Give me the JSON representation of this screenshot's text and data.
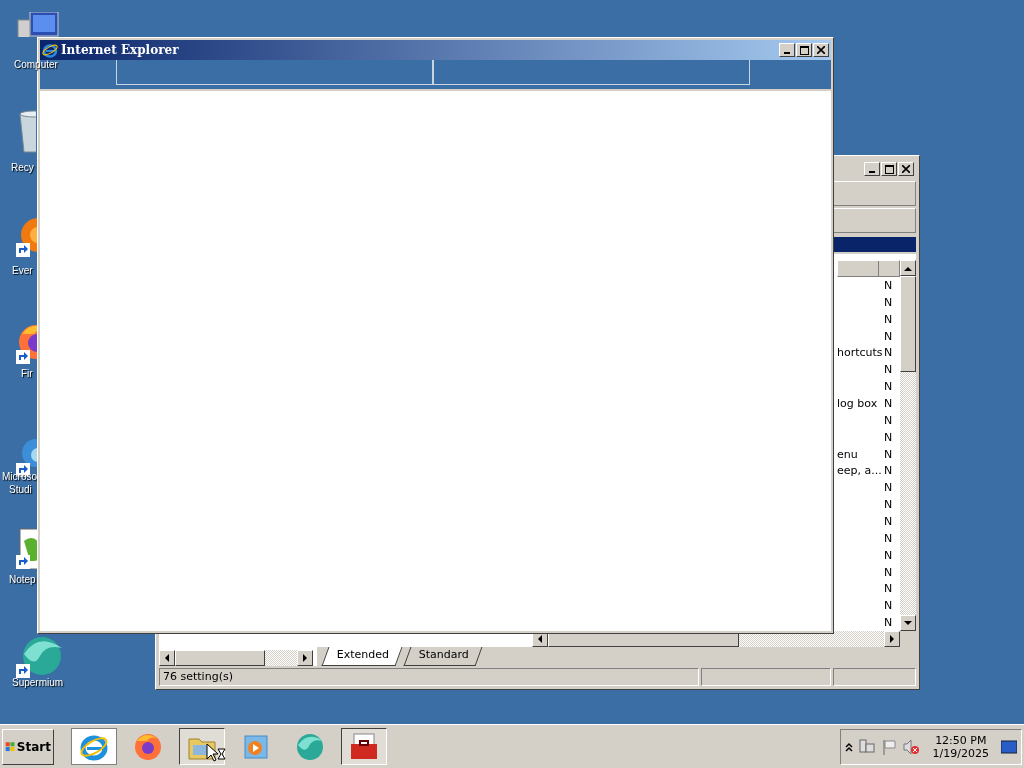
{
  "desktop_icons": [
    {
      "kind": "computer",
      "label": "Computer"
    },
    {
      "kind": "bin",
      "label": "Recy"
    },
    {
      "kind": "orange",
      "label": "Ever",
      "shortcut": true
    },
    {
      "kind": "firefox",
      "label": "Fir",
      "shortcut": true
    },
    {
      "kind": "edge",
      "label": "Microso",
      "label_2": "Studi",
      "shortcut": true
    },
    {
      "kind": "notepad",
      "label": "Notep",
      "shortcut": true
    },
    {
      "kind": "supermium",
      "label": "Supermium",
      "shortcut": true
    }
  ],
  "front_window": {
    "title": "Internet Explorer"
  },
  "back_window": {
    "rows": [
      {
        "column_1": "",
        "column_2": "N"
      },
      {
        "column_1": "",
        "column_2": "N"
      },
      {
        "column_1": "",
        "column_2": "N"
      },
      {
        "column_1": "",
        "column_2": "N"
      },
      {
        "column_1": "hortcuts",
        "column_2": "N"
      },
      {
        "column_1": "",
        "column_2": "N"
      },
      {
        "column_1": "",
        "column_2": "N"
      },
      {
        "column_1": "log box",
        "column_2": "N"
      },
      {
        "column_1": "",
        "column_2": "N"
      },
      {
        "column_1": "",
        "column_2": "N"
      },
      {
        "column_1": "enu",
        "column_2": "N"
      },
      {
        "column_1": "eep, a...",
        "column_2": "N"
      },
      {
        "column_1": "",
        "column_2": "N"
      },
      {
        "column_1": "",
        "column_2": "N"
      },
      {
        "column_1": "",
        "column_2": "N"
      },
      {
        "column_1": "",
        "column_2": "N"
      },
      {
        "column_1": "",
        "column_2": "N"
      },
      {
        "column_1": "",
        "column_2": "N"
      },
      {
        "column_1": "",
        "column_2": "N"
      },
      {
        "column_1": "",
        "column_2": "N"
      },
      {
        "column_1": "",
        "column_2": "N"
      }
    ],
    "tabs": [
      {
        "label": "Extended",
        "selected": true
      },
      {
        "label": "Standard",
        "selected": false
      }
    ],
    "status_bar": "76 setting(s)"
  },
  "taskbar": {
    "start": "Start",
    "buttons": [
      {
        "kind": "ie",
        "highlighted": true,
        "pressed": false
      },
      {
        "kind": "firefox",
        "highlighted": false,
        "pressed": false
      },
      {
        "kind": "folder",
        "highlighted": false,
        "pressed": true
      },
      {
        "kind": "media",
        "highlighted": false,
        "pressed": false
      },
      {
        "kind": "supermium",
        "highlighted": false,
        "pressed": false
      },
      {
        "kind": "toolbox",
        "highlighted": false,
        "pressed": true
      }
    ],
    "time": "12:50 PM",
    "date": "1/19/2025"
  }
}
